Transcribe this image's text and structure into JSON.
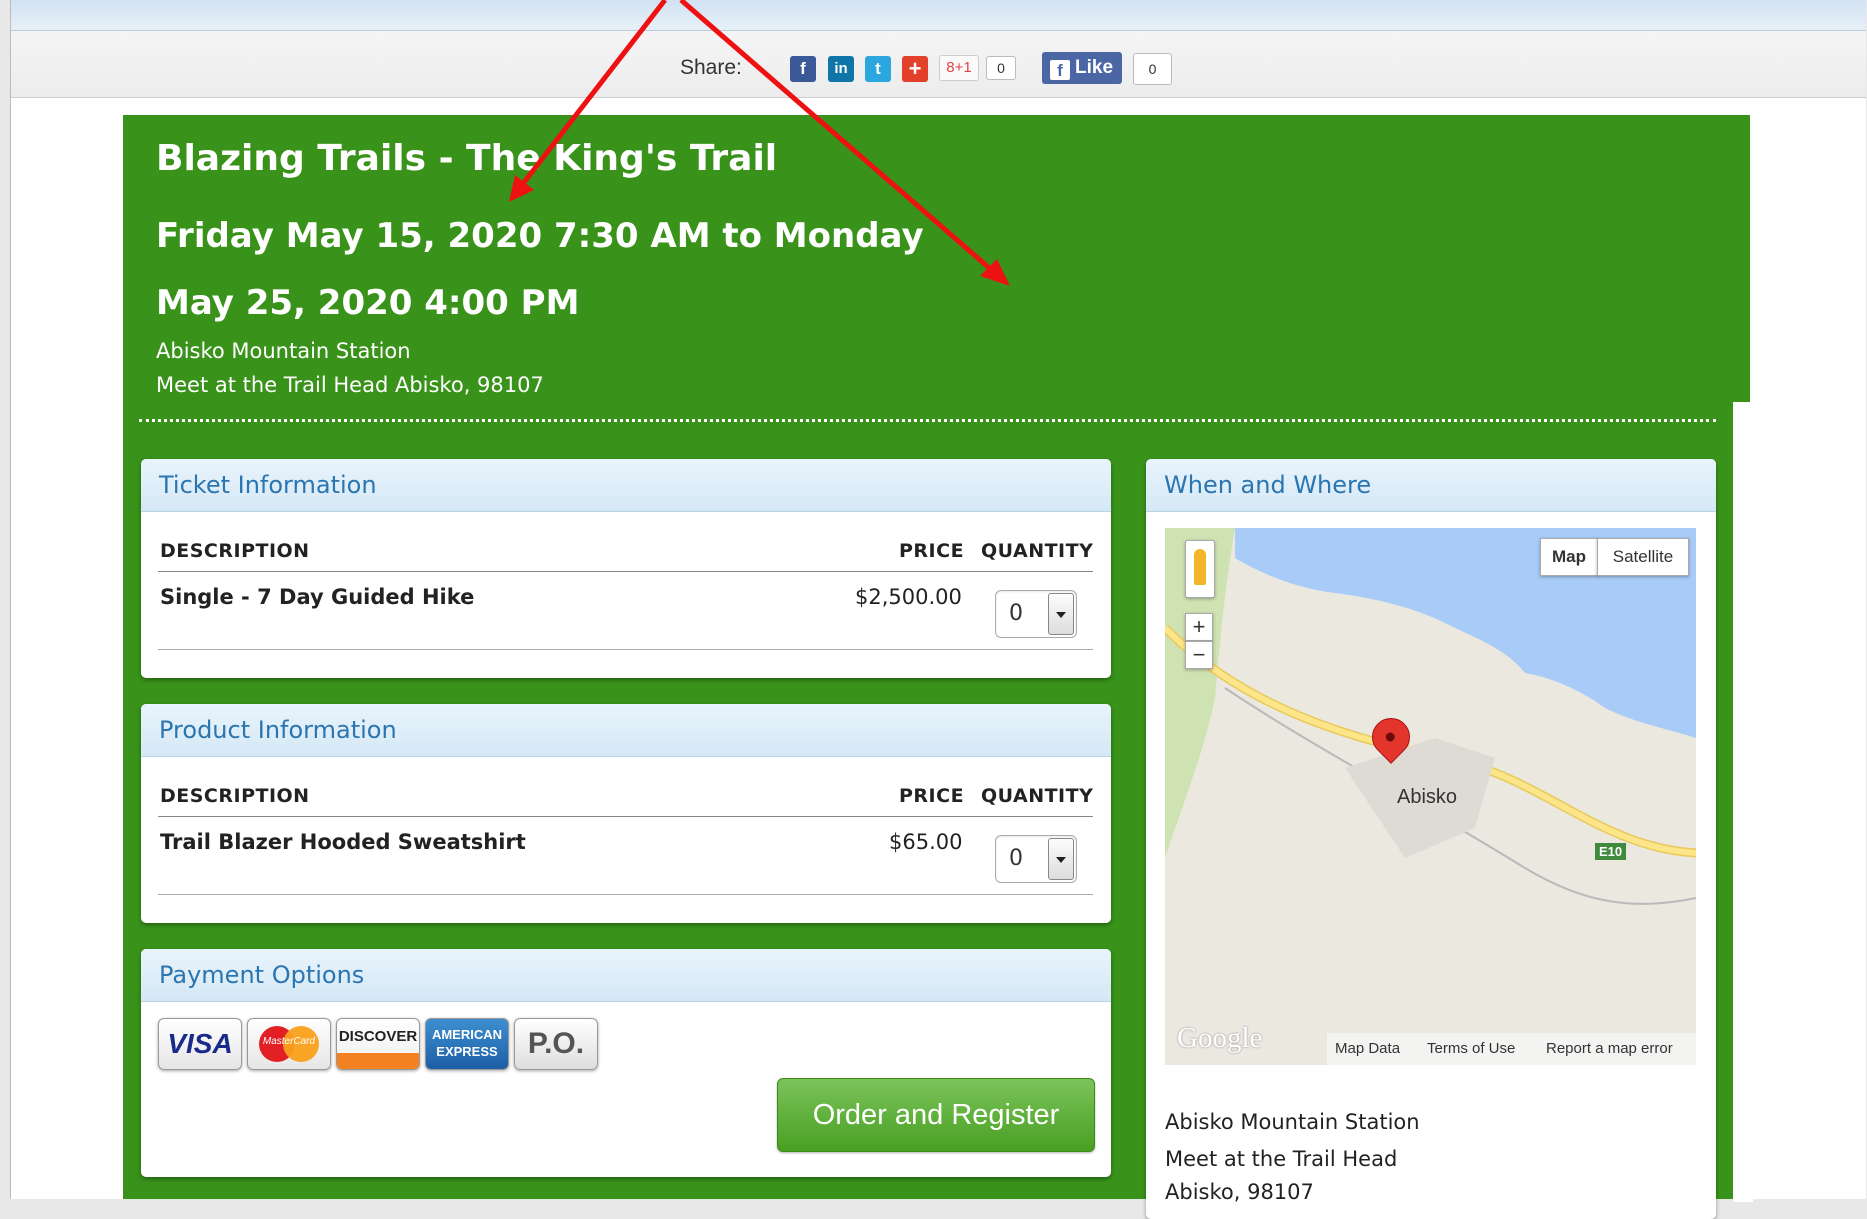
{
  "share": {
    "label": "Share:",
    "buttons": [
      {
        "name": "facebook",
        "glyph": "f",
        "color": "#3b5998"
      },
      {
        "name": "linkedin",
        "glyph": "in",
        "color": "#0e76a8"
      },
      {
        "name": "twitter",
        "glyph": "t",
        "color": "#2ba6de"
      },
      {
        "name": "addthis",
        "glyph": "+",
        "color": "#e2402b"
      }
    ],
    "gplus_label": "8+1",
    "gplus_count": "0",
    "fb_like_label": "Like",
    "fb_like_count": "0"
  },
  "event": {
    "title": "Blazing Trails - The King's Trail",
    "date_line1": "Friday May 15, 2020 7:30 AM to Monday",
    "date_line2": "May 25, 2020 4:00 PM",
    "venue": "Abisko Mountain Station",
    "address": "Meet at the Trail Head Abisko, 98107"
  },
  "tickets": {
    "heading": "Ticket Information",
    "col_description": "DESCRIPTION",
    "col_price": "PRICE",
    "col_quantity": "QUANTITY",
    "rows": [
      {
        "description": "Single - 7 Day Guided Hike",
        "price": "$2,500.00",
        "quantity": "0"
      }
    ]
  },
  "products": {
    "heading": "Product Information",
    "col_description": "DESCRIPTION",
    "col_price": "PRICE",
    "col_quantity": "QUANTITY",
    "rows": [
      {
        "description": "Trail Blazer Hooded Sweatshirt",
        "price": "$65.00",
        "quantity": "0"
      }
    ]
  },
  "payment": {
    "heading": "Payment Options",
    "cards": [
      {
        "name": "visa",
        "label": "VISA"
      },
      {
        "name": "mastercard",
        "label": "MasterCard"
      },
      {
        "name": "discover",
        "label": "DISCOVER"
      },
      {
        "name": "amex",
        "label": "AMERICAN EXPRESS"
      },
      {
        "name": "po",
        "label": "P.O."
      }
    ],
    "order_button": "Order and Register"
  },
  "when_where": {
    "heading": "When and Where",
    "map": {
      "type_map": "Map",
      "type_satellite": "Satellite",
      "zoom_in": "+",
      "zoom_out": "−",
      "town_label": "Abisko",
      "road_label": "E10",
      "logo": "Google",
      "map_data": "Map Data",
      "terms": "Terms of Use",
      "report": "Report a map error"
    },
    "venue": "Abisko Mountain Station",
    "address_line1": "Meet at the Trail Head",
    "address_line2": "Abisko, 98107"
  },
  "colors": {
    "page_green": "#39921a",
    "panel_heading_text": "#2b75b0",
    "button_green": "#5cb036",
    "annotation_arrow": "#ee1111"
  }
}
